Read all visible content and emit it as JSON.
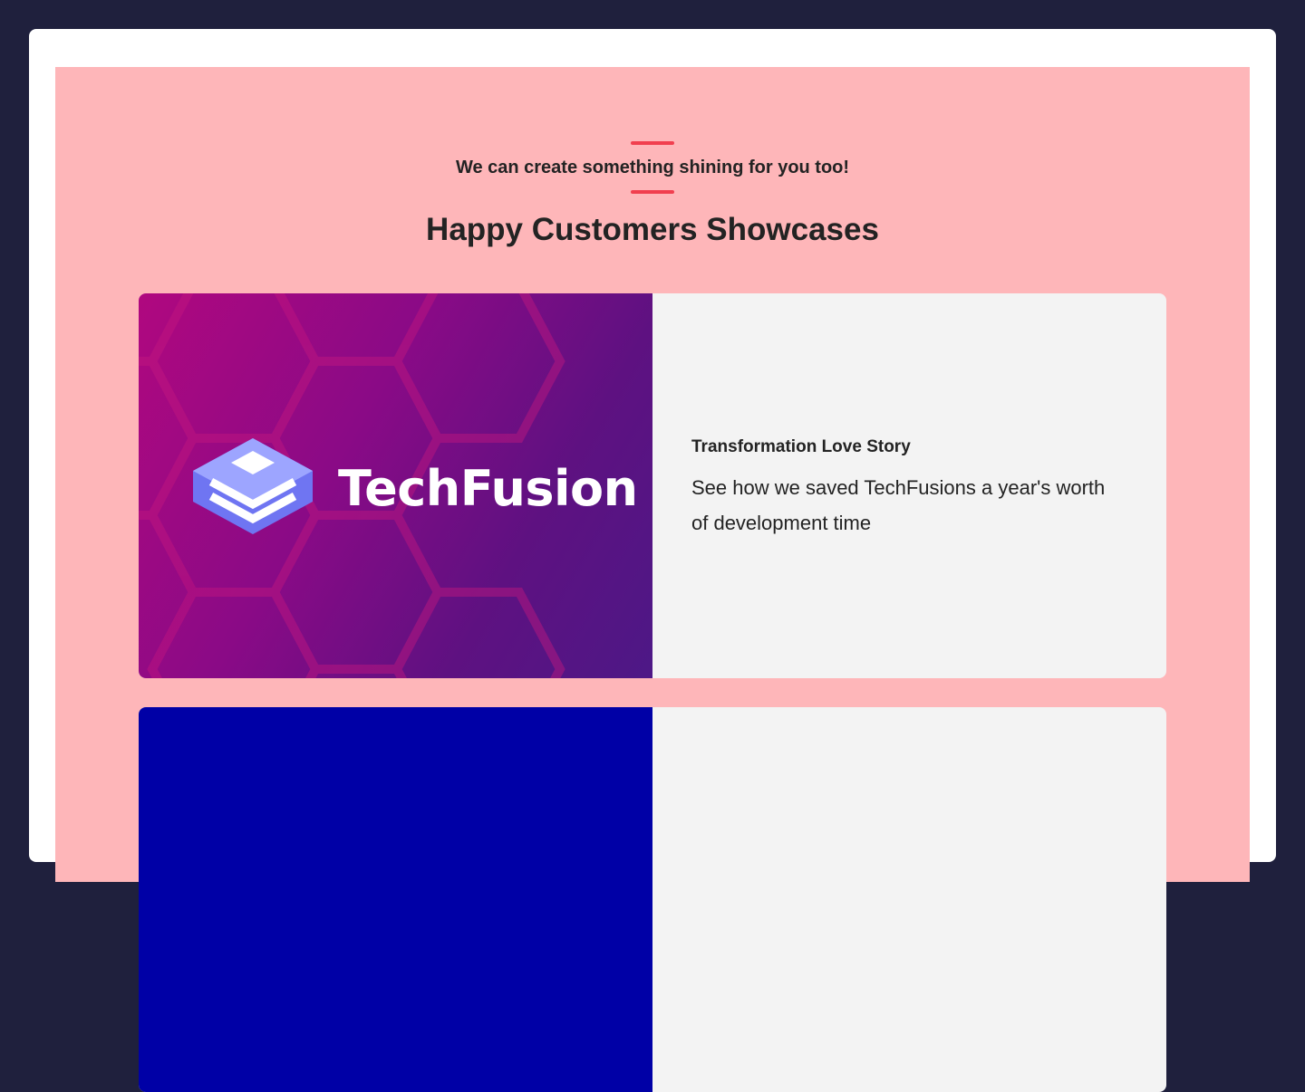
{
  "intro": {
    "tagline": "We can create something shining for you too!",
    "heading": "Happy Customers Showcases"
  },
  "showcases": [
    {
      "brand": "TechFusion",
      "title": "Transformation Love Story",
      "description": "See how we saved TechFusions a year's worth of development time"
    },
    {
      "title": "",
      "description": ""
    }
  ],
  "colors": {
    "page_background": "#1f203d",
    "section_background": "#feb6b9",
    "accent": "#f13f4f",
    "card_background": "#f3f3f3",
    "second_card_media": "#0000a6"
  }
}
